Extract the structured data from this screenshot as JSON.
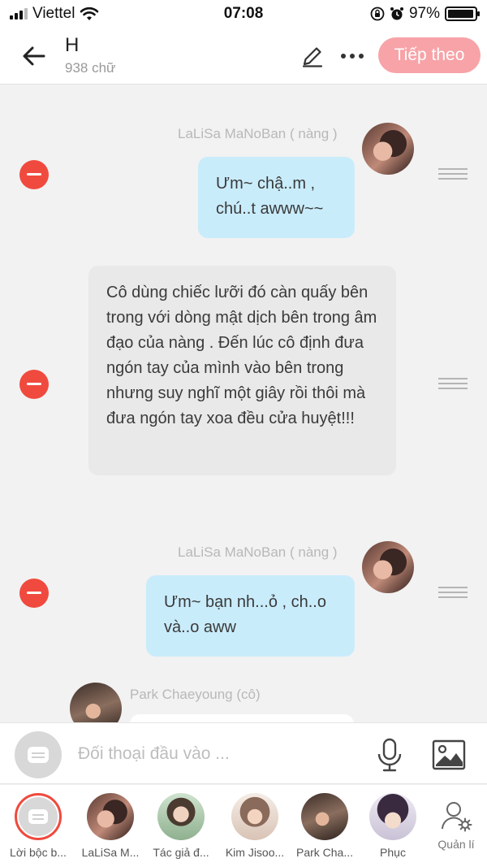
{
  "status_bar": {
    "carrier": "Viettel",
    "time": "07:08",
    "battery": "97%",
    "battery_level": 0.97
  },
  "header": {
    "title": "H",
    "subtitle": "938 chữ",
    "next_label": "Tiếp theo"
  },
  "messages": [
    {
      "sender": "LaLiSa MaNoBan ( nàng )",
      "text": "Ưm~ chậ..m ,\nchú..t awww~~",
      "style": "blue"
    },
    {
      "sender": "",
      "text": "Cô dùng chiếc lưỡi đó càn quấy bên trong với dòng mật dịch bên trong âm đạo của nàng . Đến lúc cô định đưa ngón tay của mình vào bên trong nhưng suy nghĩ một giây rồi thôi mà đưa ngón tay xoa đều cửa huyệt!!!",
      "style": "gray"
    },
    {
      "sender": "LaLiSa MaNoBan ( nàng )",
      "text": "Ưm~ bạn nh...ỏ , ch..o\nvà..o aww",
      "style": "blue"
    },
    {
      "sender": "Park Chaeyoung (cô)",
      "text": "",
      "style": "white"
    }
  ],
  "composer": {
    "placeholder": "Đối thoại đầu vào ..."
  },
  "characters": [
    {
      "label": "Lời bộc b..."
    },
    {
      "label": "LaLiSa M..."
    },
    {
      "label": "Tác giả đ..."
    },
    {
      "label": "Kim Jisoo..."
    },
    {
      "label": "Park Cha..."
    },
    {
      "label": "Phục"
    }
  ],
  "manage_label": "Quản lí",
  "icons": {
    "back": "arrow-left-icon",
    "edit": "pencil-icon",
    "more": "more-icon",
    "remove": "minus-circle-icon",
    "drag": "drag-handle-icon",
    "mic": "microphone-icon",
    "image": "image-icon",
    "manage": "user-gear-icon"
  },
  "colors": {
    "accent": "#f7a3a8",
    "remove": "#f04a3e",
    "bubble_blue": "#c9ecfb",
    "bubble_gray": "#e9e9e9"
  }
}
